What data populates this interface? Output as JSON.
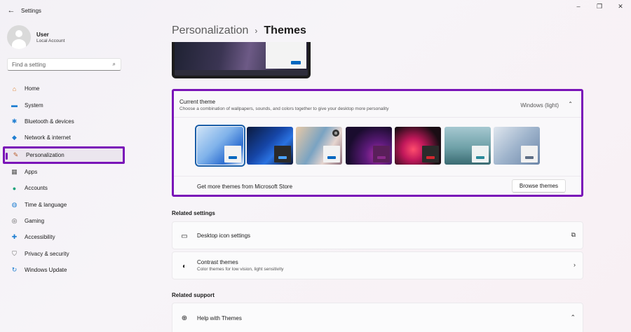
{
  "window": {
    "title": "Settings",
    "back_icon": "←",
    "minimize": "–",
    "maximize": "❐",
    "close": "✕"
  },
  "user": {
    "name": "User",
    "account_type": "Local Account"
  },
  "search": {
    "placeholder": "Find a setting",
    "icon": "⌕"
  },
  "nav": [
    {
      "label": "Home",
      "icon": "home-icon",
      "glyph": "⌂",
      "color": "#e0822f"
    },
    {
      "label": "System",
      "icon": "system-icon",
      "glyph": "▬",
      "color": "#1f7fd1"
    },
    {
      "label": "Bluetooth & devices",
      "icon": "bluetooth-icon",
      "glyph": "✱",
      "color": "#1f7fd1"
    },
    {
      "label": "Network & internet",
      "icon": "wifi-icon",
      "glyph": "◆",
      "color": "#1f7fd1"
    },
    {
      "label": "Personalization",
      "icon": "brush-icon",
      "glyph": "✎",
      "color": "#b85c2a"
    },
    {
      "label": "Apps",
      "icon": "apps-icon",
      "glyph": "▦",
      "color": "#555555"
    },
    {
      "label": "Accounts",
      "icon": "accounts-icon",
      "glyph": "●",
      "color": "#1aa37a"
    },
    {
      "label": "Time & language",
      "icon": "globe-clock-icon",
      "glyph": "◍",
      "color": "#1f7fd1"
    },
    {
      "label": "Gaming",
      "icon": "gamepad-icon",
      "glyph": "◎",
      "color": "#555555"
    },
    {
      "label": "Accessibility",
      "icon": "accessibility-icon",
      "glyph": "✚",
      "color": "#1f7fd1"
    },
    {
      "label": "Privacy & security",
      "icon": "shield-icon",
      "glyph": "⛉",
      "color": "#6b6b6b"
    },
    {
      "label": "Windows Update",
      "icon": "update-icon",
      "glyph": "↻",
      "color": "#1f7fd1"
    }
  ],
  "active_nav": "Personalization",
  "breadcrumb": {
    "parent": "Personalization",
    "separator": "›",
    "current": "Themes"
  },
  "current_theme": {
    "title": "Current theme",
    "subtitle": "Choose a combination of wallpapers, sounds, and colors together to give your desktop more personality",
    "value": "Windows (light)",
    "chevron": "⌃",
    "themes": [
      {
        "name": "windows-light",
        "bg": "linear-gradient(135deg,#cfe3f7 0%,#7fb2ea 45%,#2f6fd1 75%,#dbe9f8 100%)",
        "win": "#f2f2f2",
        "accent": "#0067c0",
        "selected": true
      },
      {
        "name": "windows-dark",
        "bg": "linear-gradient(135deg,#0b1a3d 0%,#1646a8 45%,#2a72e0 65%,#0d1636 100%)",
        "win": "#2a2a2a",
        "accent": "#4aa3ff",
        "selected": false
      },
      {
        "name": "spotlight",
        "bg": "linear-gradient(120deg,#e9c9a6 0%,#7aa3c2 45%,#e6d5cf 70%,#8c6d7b 100%)",
        "win": "#f2f2f2",
        "accent": "#0067c0",
        "selected": false
      },
      {
        "name": "glow",
        "bg": "radial-gradient(circle at 70% 75%,#b02fa8 0%,#5d1a7a 30%,#1a0c2e 70%)",
        "win": "#5a1f5a",
        "accent": "#8a2a8a",
        "selected": false
      },
      {
        "name": "captured-motion",
        "bg": "radial-gradient(circle at 40% 60%,#ff4d6d 0%,#c2185b 30%,#1a0d14 75%)",
        "win": "#2b2b2b",
        "accent": "#d1272f",
        "selected": false
      },
      {
        "name": "flow",
        "bg": "linear-gradient(180deg,#a6c8d1 0%,#6fa1a8 55%,#3a6b72 100%)",
        "win": "#eef2f2",
        "accent": "#2a8a9a",
        "selected": false
      },
      {
        "name": "sunrise",
        "bg": "linear-gradient(135deg,#dfe6ee 0%,#9fb4cc 50%,#6c86a8 100%)",
        "win": "#f2f2f2",
        "accent": "#5f6f85",
        "selected": false
      }
    ],
    "badge_glyph": "⊛",
    "more_text": "Get more themes from Microsoft Store",
    "browse_label": "Browse themes"
  },
  "related_settings": {
    "title": "Related settings",
    "items": [
      {
        "title": "Desktop icon settings",
        "subtitle": "",
        "icon_glyph": "▭",
        "end_glyph": "⧉"
      },
      {
        "title": "Contrast themes",
        "subtitle": "Color themes for low vision, light sensitivity",
        "icon_glyph": "◐",
        "end_glyph": "›"
      }
    ]
  },
  "related_support": {
    "title": "Related support",
    "items": [
      {
        "title": "Help with Themes",
        "icon_glyph": "⊕",
        "end_glyph": "⌃"
      }
    ]
  },
  "colors": {
    "highlight": "#7a14b8",
    "accent": "#0067c0"
  }
}
